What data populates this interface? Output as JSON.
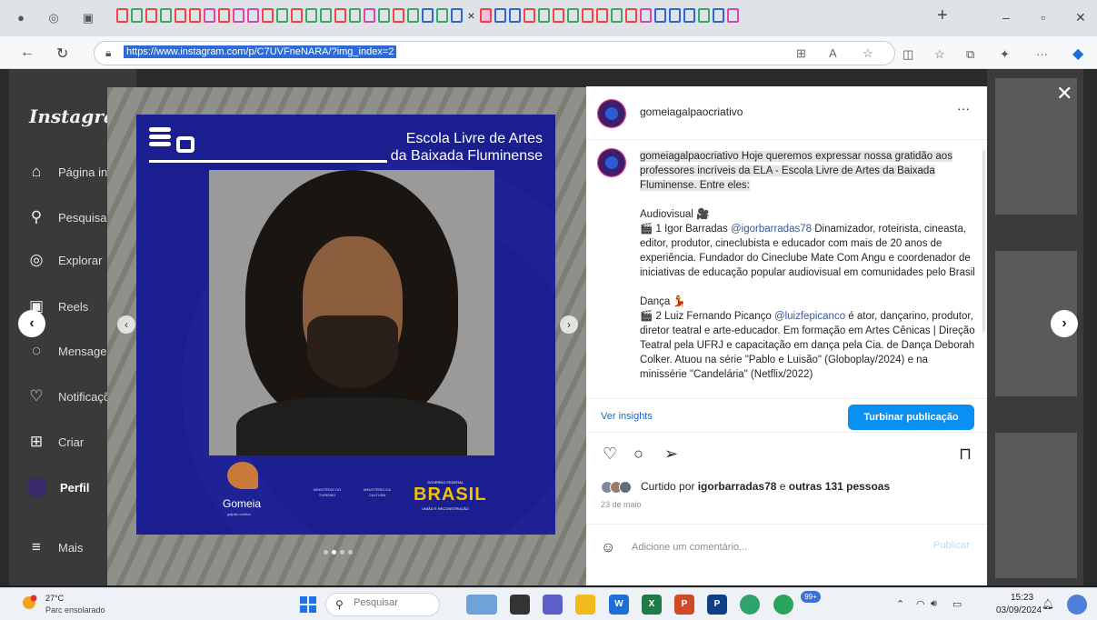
{
  "browser": {
    "url": "https://www.instagram.com/p/C7UVFneNARA/?img_index=2",
    "new_tab": "+",
    "tab_close": "×",
    "minimize": "–",
    "restore": "▫",
    "close": "✕"
  },
  "instagram": {
    "logo": "Instagram",
    "nav": [
      {
        "label": "Página inicial",
        "icon": "home-icon"
      },
      {
        "label": "Pesquisa",
        "icon": "search-icon"
      },
      {
        "label": "Explorar",
        "icon": "compass-icon"
      },
      {
        "label": "Reels",
        "icon": "reels-icon"
      },
      {
        "label": "Mensagens",
        "icon": "messenger-icon"
      },
      {
        "label": "Notificações",
        "icon": "heart-icon"
      },
      {
        "label": "Criar",
        "icon": "plus-square-icon"
      },
      {
        "label": "Perfil",
        "icon": "profile-avatar-icon"
      },
      {
        "label": "Mais",
        "icon": "menu-icon"
      }
    ]
  },
  "post_image": {
    "title_line1": "Escola Livre de Artes",
    "title_line2": "da Baixada Fluminense",
    "gomeia_logo": "Gomeia",
    "gomeia_sub": "galpão criativo",
    "ministry1": "MINISTÉRIO DO TURISMO",
    "ministry2": "MINISTÉRIO DA CULTURA",
    "gov_top": "GOVERNO FEDERAL",
    "gov_word": "BRASIL",
    "gov_sub": "UNIÃO E RECONSTRUÇÃO"
  },
  "post": {
    "username": "gomeiagalpaocriativo",
    "more": "···",
    "caption_user": "gomeiagalpaocriativo",
    "caption_intro_1": "Hoje queremos expressar nossa gratidão",
    "caption_intro_2": "aos professores incríveis da ELA - Escola Livre de Artes da Baixada Fluminense. Entre eles:",
    "section1_title": "Audiovisual 🎥",
    "section1_lead": "🎬 1 Igor Barradas ",
    "section1_mention": "@igorbarradas78",
    "section1_text": " Dinamizador, roteirista, cineasta, editor, produtor, cineclubista e educador com mais de 20 anos de experiência. Fundador do Cineclube Mate Com Angu e coordenador de iniciativas de educação popular audiovisual em comunidades pelo Brasil",
    "section2_title": "Dança 💃",
    "section2_lead": "🎬 2 Luiz Fernando Picanço ",
    "section2_mention": "@luizfepicanco",
    "section2_text": " é ator, dançarino, produtor, diretor teatral e arte-educador. Em formação em Artes Cênicas | Direção Teatral pela UFRJ e capacitação em dança pela Cia. de Dança Deborah Colker. Atuou na série \"Pablo e Luisão\" (Globoplay/2024) e na minissérie \"Candelária\" (Netflix/2022)",
    "ver_insights": "Ver insights",
    "boost_button": "Turbinar publicação",
    "likes_prefix": "Curtido por ",
    "likes_user": "igorbarradas78",
    "likes_mid": " e ",
    "likes_others": "outras 131 pessoas",
    "date": "23 de maio",
    "comment_placeholder": "Adicione um comentário...",
    "publish": "Publicar"
  },
  "taskbar": {
    "temperature": "27°C",
    "weather": "Parc ensolarado",
    "search_placeholder": "Pesquisar",
    "notification_badge": "99+",
    "time": "15:23",
    "date": "03/09/2024"
  },
  "colors": {
    "accent_blue": "#0a8ff2",
    "post_bg": "#1b1e8e",
    "brasil_yellow": "#f2c200"
  }
}
